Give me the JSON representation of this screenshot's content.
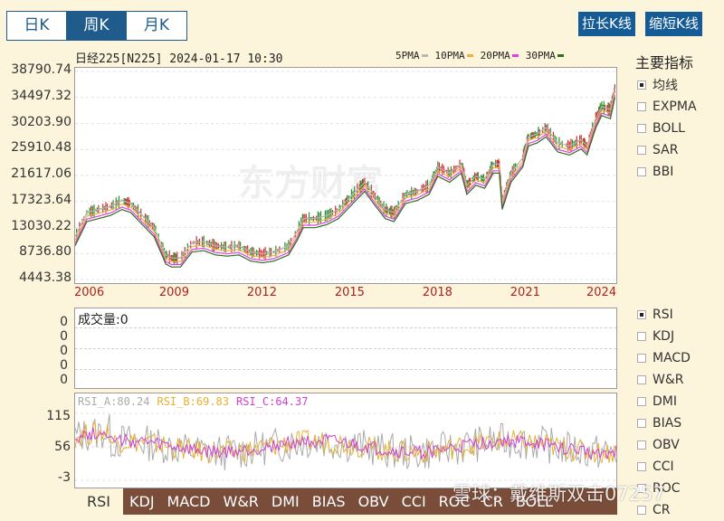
{
  "period_tabs": [
    {
      "label": "日K",
      "active": false
    },
    {
      "label": "周K",
      "active": true
    },
    {
      "label": "月K",
      "active": false
    }
  ],
  "zoom": {
    "longer": "拉长K线",
    "shorter": "缩短K线"
  },
  "chart_header": {
    "title": "日经225[N225] 2024-01-17 10:30"
  },
  "ma_legend": [
    {
      "label": "5PMA",
      "color": "#b8b8b8"
    },
    {
      "label": "10PMA",
      "color": "#f0b040"
    },
    {
      "label": "20PMA",
      "color": "#e040e0"
    },
    {
      "label": "30PMA",
      "color": "#2e6e1e"
    }
  ],
  "main_indicators": {
    "title": "主要指标",
    "items": [
      {
        "label": "均线",
        "checked": true
      },
      {
        "label": "EXPMA",
        "checked": false
      },
      {
        "label": "BOLL",
        "checked": false
      },
      {
        "label": "SAR",
        "checked": false
      },
      {
        "label": "BBI",
        "checked": false
      }
    ]
  },
  "sub_indicators": [
    {
      "label": "RSI",
      "checked": true
    },
    {
      "label": "KDJ",
      "checked": false
    },
    {
      "label": "MACD",
      "checked": false
    },
    {
      "label": "W&R",
      "checked": false
    },
    {
      "label": "DMI",
      "checked": false
    },
    {
      "label": "BIAS",
      "checked": false
    },
    {
      "label": "OBV",
      "checked": false
    },
    {
      "label": "CCI",
      "checked": false
    },
    {
      "label": "ROC",
      "checked": false
    },
    {
      "label": "CR",
      "checked": false
    }
  ],
  "volume": {
    "label": "成交量:0",
    "y_ticks": [
      "0",
      "0",
      "0",
      "0",
      "0"
    ]
  },
  "rsi": {
    "labels": [
      {
        "text": "RSI_A:80.24",
        "color": "#aaaaaa"
      },
      {
        "text": "RSI_B:69.83",
        "color": "#e8b030"
      },
      {
        "text": "RSI_C:64.37",
        "color": "#d040d0"
      }
    ],
    "y_ticks": [
      "115",
      "56",
      "-3"
    ]
  },
  "bottom_tabs": [
    {
      "label": "RSI",
      "active": true
    },
    {
      "label": "KDJ"
    },
    {
      "label": "MACD"
    },
    {
      "label": "W&R"
    },
    {
      "label": "DMI"
    },
    {
      "label": "BIAS"
    },
    {
      "label": "OBV"
    },
    {
      "label": "CCI"
    },
    {
      "label": "ROC"
    },
    {
      "label": "CR"
    },
    {
      "label": "BOLL"
    }
  ],
  "watermark": {
    "main": "东方财富",
    "xueqiu": "雪球：戴维斯双击07257"
  },
  "chart_data": {
    "type": "line",
    "series_name": "日经225",
    "y_ticks": [
      "38790.74",
      "34497.32",
      "30203.90",
      "25910.48",
      "21617.06",
      "17323.64",
      "13030.22",
      "8736.80",
      "4443.38"
    ],
    "ylim": [
      4443.38,
      38790.74
    ],
    "x_ticks": [
      "2006",
      "2009",
      "2012",
      "2015",
      "2018",
      "2021",
      "2024"
    ],
    "xlim": [
      2005.6,
      2024.1
    ],
    "x": [
      2005.6,
      2006.0,
      2006.4,
      2006.8,
      2007.2,
      2007.5,
      2007.9,
      2008.3,
      2008.7,
      2008.9,
      2009.2,
      2009.6,
      2010.0,
      2010.4,
      2010.8,
      2011.2,
      2011.6,
      2012.0,
      2012.4,
      2012.9,
      2013.2,
      2013.4,
      2013.8,
      2014.2,
      2014.6,
      2014.9,
      2015.3,
      2015.5,
      2015.8,
      2016.2,
      2016.5,
      2016.9,
      2017.3,
      2017.7,
      2018.0,
      2018.4,
      2018.8,
      2018.99,
      2019.3,
      2019.6,
      2019.9,
      2020.1,
      2020.2,
      2020.5,
      2020.9,
      2021.1,
      2021.4,
      2021.7,
      2022.1,
      2022.5,
      2022.9,
      2023.1,
      2023.4,
      2023.6,
      2023.9,
      2024.05
    ],
    "y": [
      11500,
      15500,
      16000,
      16500,
      17500,
      17000,
      15000,
      13000,
      8500,
      8000,
      8000,
      10500,
      10700,
      10000,
      9800,
      10000,
      9000,
      8700,
      9000,
      10000,
      12500,
      14500,
      14500,
      15000,
      16000,
      17500,
      19500,
      20500,
      18500,
      16000,
      15500,
      18500,
      19000,
      20000,
      23000,
      22000,
      23500,
      20000,
      21500,
      21000,
      23500,
      23500,
      17500,
      22000,
      24500,
      28000,
      28500,
      29500,
      27000,
      26500,
      27500,
      26500,
      31000,
      33000,
      32500,
      36000
    ],
    "rsi_ylim": [
      -3,
      115
    ]
  }
}
